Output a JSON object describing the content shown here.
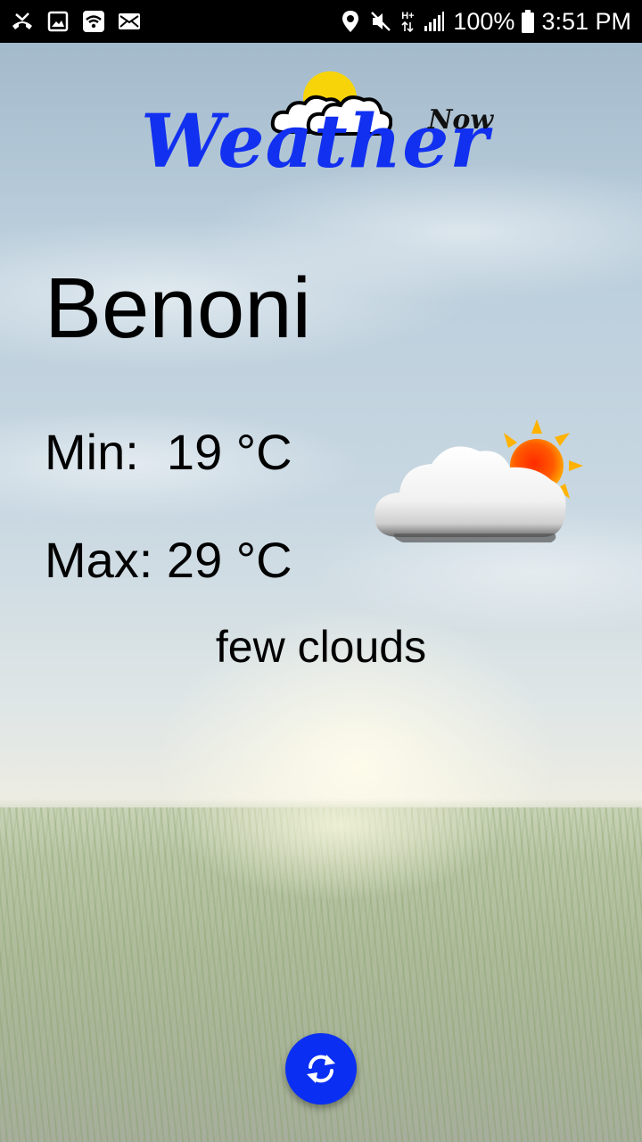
{
  "status_bar": {
    "battery_percent": "100%",
    "time": "3:51 PM",
    "network_type": "H+",
    "left_icons": [
      "missed-call-icon",
      "gallery-icon",
      "wifi-icon",
      "email-icon"
    ],
    "right_icons": [
      "location-icon",
      "mute-icon",
      "data-icon",
      "signal-icon",
      "battery-icon"
    ]
  },
  "logo": {
    "word": "Weather",
    "tag": "Now",
    "colors": {
      "word": "#1130f0",
      "tag": "#111111",
      "sun": "#f7d40a"
    }
  },
  "weather": {
    "city": "Benoni",
    "min_label": "Min:",
    "min_value": "19 °C",
    "max_label": "Max:",
    "max_value": "29 °C",
    "description": "few clouds",
    "condition_icon": "partly-cloudy-icon"
  },
  "actions": {
    "refresh_icon": "refresh-icon",
    "refresh_color": "#0a2ff2"
  }
}
